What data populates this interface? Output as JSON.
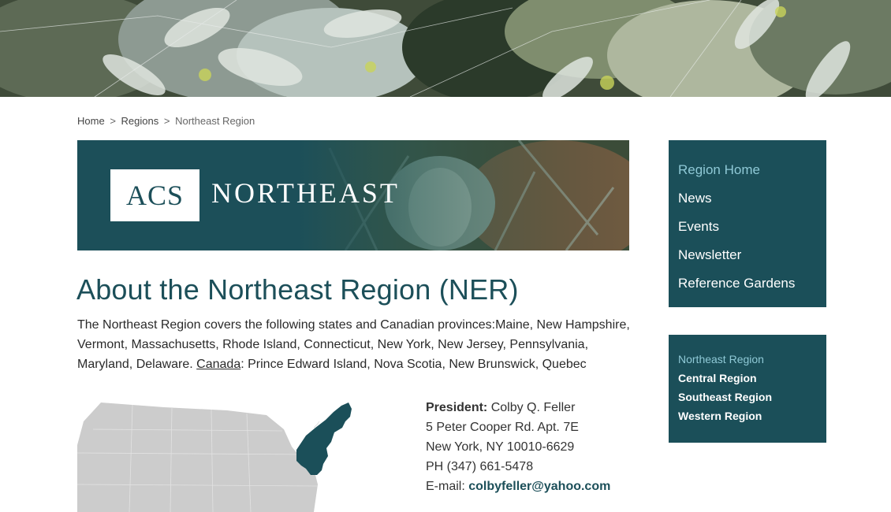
{
  "breadcrumb": {
    "items": [
      "Home",
      "Regions",
      "Northeast Region"
    ],
    "separator": ">"
  },
  "banner": {
    "logo_acs": "ACS",
    "logo_word": "NORTHEAST"
  },
  "main": {
    "title": "About the Northeast Region (NER)",
    "intro_before": "The Northeast Region covers the following states and Canadian provinces:Maine, New Hampshire, Vermont, Massachusetts, Rhode Island, Connecticut, New York, New Jersey, Pennsylvania, Maryland, Delaware. ",
    "intro_link": "Canada",
    "intro_after": ": Prince Edward Island, Nova Scotia, New Brunswick, Quebec"
  },
  "contact": {
    "president_label": "President:",
    "president_name": " Colby Q. Feller",
    "address1": "5 Peter Cooper Rd. Apt. 7E",
    "address2": "New York, NY 10010-6629",
    "phone": "PH (347) 661-5478",
    "email_label": "E-mail: ",
    "email": "colbyfeller@yahoo.com"
  },
  "sidebar": {
    "nav": [
      {
        "label": "Region Home",
        "active": true
      },
      {
        "label": "News",
        "active": false
      },
      {
        "label": "Events",
        "active": false
      },
      {
        "label": "Newsletter",
        "active": false
      },
      {
        "label": "Reference Gardens",
        "active": false
      }
    ],
    "regions": [
      {
        "label": "Northeast Region",
        "active": true
      },
      {
        "label": "Central Region",
        "active": false
      },
      {
        "label": "Southeast Region",
        "active": false
      },
      {
        "label": "Western Region",
        "active": false
      }
    ]
  },
  "colors": {
    "brand": "#1b4f59",
    "active_link": "#8fc9d6",
    "map_gray": "#cccccc"
  }
}
